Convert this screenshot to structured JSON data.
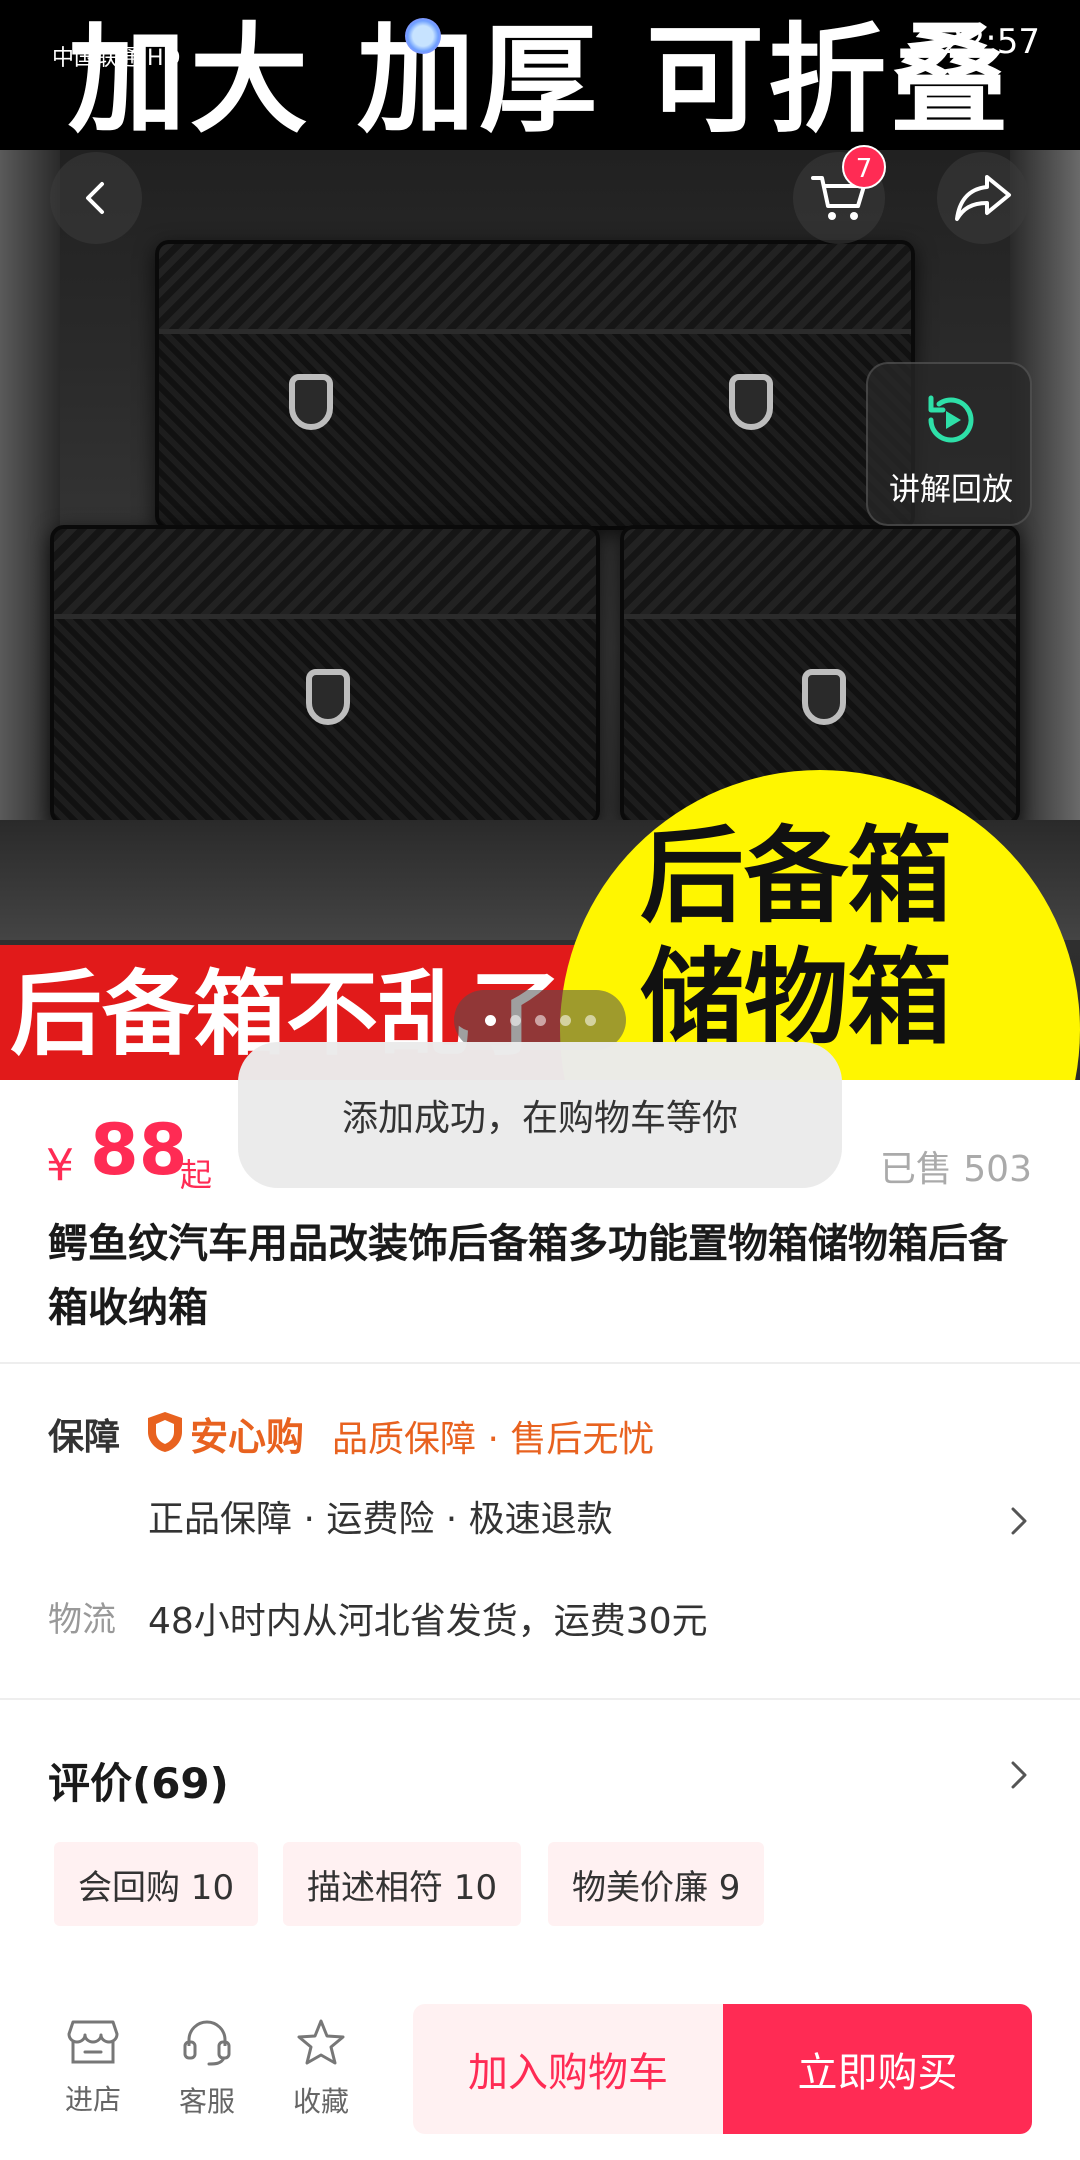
{
  "status_bar": {
    "carrier": "中国联通 HD",
    "time": "22:57"
  },
  "hero": {
    "headline": "加大 加厚 可折叠",
    "banner_red": "后备箱不乱了",
    "banner_yellow_line1": "后备箱",
    "banner_yellow_line2": "储物箱",
    "cart_count": "7",
    "replay_label": "讲解回放",
    "carousel_active_index": 0,
    "carousel_count": 5
  },
  "toast": {
    "message": "添加成功，在购物车等你"
  },
  "product": {
    "currency": "¥",
    "price": "88",
    "price_suffix": "起",
    "sold": "已售 503",
    "title": "鳄鱼纹汽车用品改装饰后备箱多功能置物箱储物箱后备箱收纳箱"
  },
  "guarantee": {
    "label": "保障",
    "brand": "安心购",
    "brand_sub": "品质保障 · 售后无忧",
    "features": "正品保障 · 运费险 · 极速退款"
  },
  "shipping": {
    "label": "物流",
    "text": "48小时内从河北省发货，运费30元"
  },
  "reviews": {
    "title": "评价(69)",
    "tags": [
      "会回购 10",
      "描述相符 10",
      "物美价廉 9"
    ]
  },
  "bottom_nav": {
    "store": "进店",
    "service": "客服",
    "favorite": "收藏",
    "add_to_cart": "加入购物车",
    "buy_now": "立即购买"
  },
  "colors": {
    "accent": "#ff2b54",
    "guarantee_orange": "#e8621f",
    "tag_bg": "#fff1f2"
  }
}
